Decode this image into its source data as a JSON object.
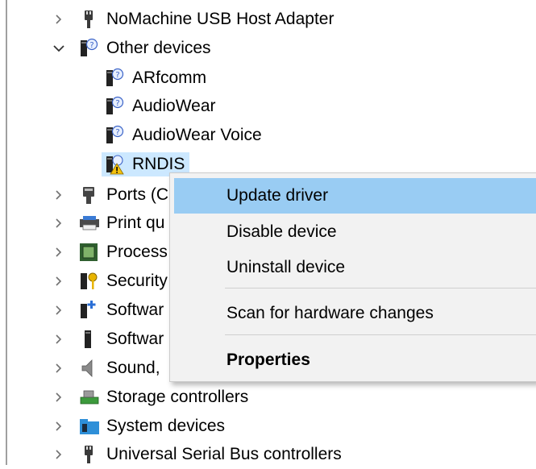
{
  "tree": {
    "items": [
      {
        "label": "NoMachine USB Host Adapter",
        "expanded": false,
        "icon": "usb-plug-icon"
      },
      {
        "label": "Other devices",
        "expanded": true,
        "icon": "unknown-device-icon"
      },
      {
        "label": "ARfcomm",
        "icon": "unknown-device-icon"
      },
      {
        "label": "AudioWear",
        "icon": "unknown-device-icon"
      },
      {
        "label": "AudioWear Voice",
        "icon": "unknown-device-icon"
      },
      {
        "label": "RNDIS",
        "icon": "warning-device-icon",
        "selected": true
      },
      {
        "label": "Ports (C",
        "expanded": false,
        "icon": "port-icon"
      },
      {
        "label": "Print qu",
        "expanded": false,
        "icon": "printer-icon"
      },
      {
        "label": "Process",
        "expanded": false,
        "icon": "processor-icon"
      },
      {
        "label": "Security",
        "expanded": false,
        "icon": "security-key-icon"
      },
      {
        "label": "Softwar",
        "expanded": false,
        "icon": "software-component-icon"
      },
      {
        "label": "Softwar",
        "expanded": false,
        "icon": "software-device-icon"
      },
      {
        "label": "Sound,",
        "expanded": false,
        "icon": "speaker-icon"
      },
      {
        "label": "Storage controllers",
        "expanded": false,
        "icon": "storage-controller-icon"
      },
      {
        "label": "System devices",
        "expanded": false,
        "icon": "system-folder-icon"
      },
      {
        "label": "Universal Serial Bus controllers",
        "expanded": false,
        "icon": "usb-plug-icon"
      }
    ]
  },
  "context_menu": {
    "items": [
      {
        "label": "Update driver",
        "highlighted": true
      },
      {
        "label": "Disable device"
      },
      {
        "label": "Uninstall device"
      },
      {
        "label": "Scan for hardware changes"
      },
      {
        "label": "Properties",
        "bold": true
      }
    ]
  },
  "colors": {
    "menu_bg": "#f2f2f2",
    "highlight": "#99ccf3",
    "selection": "#cce8ff"
  }
}
